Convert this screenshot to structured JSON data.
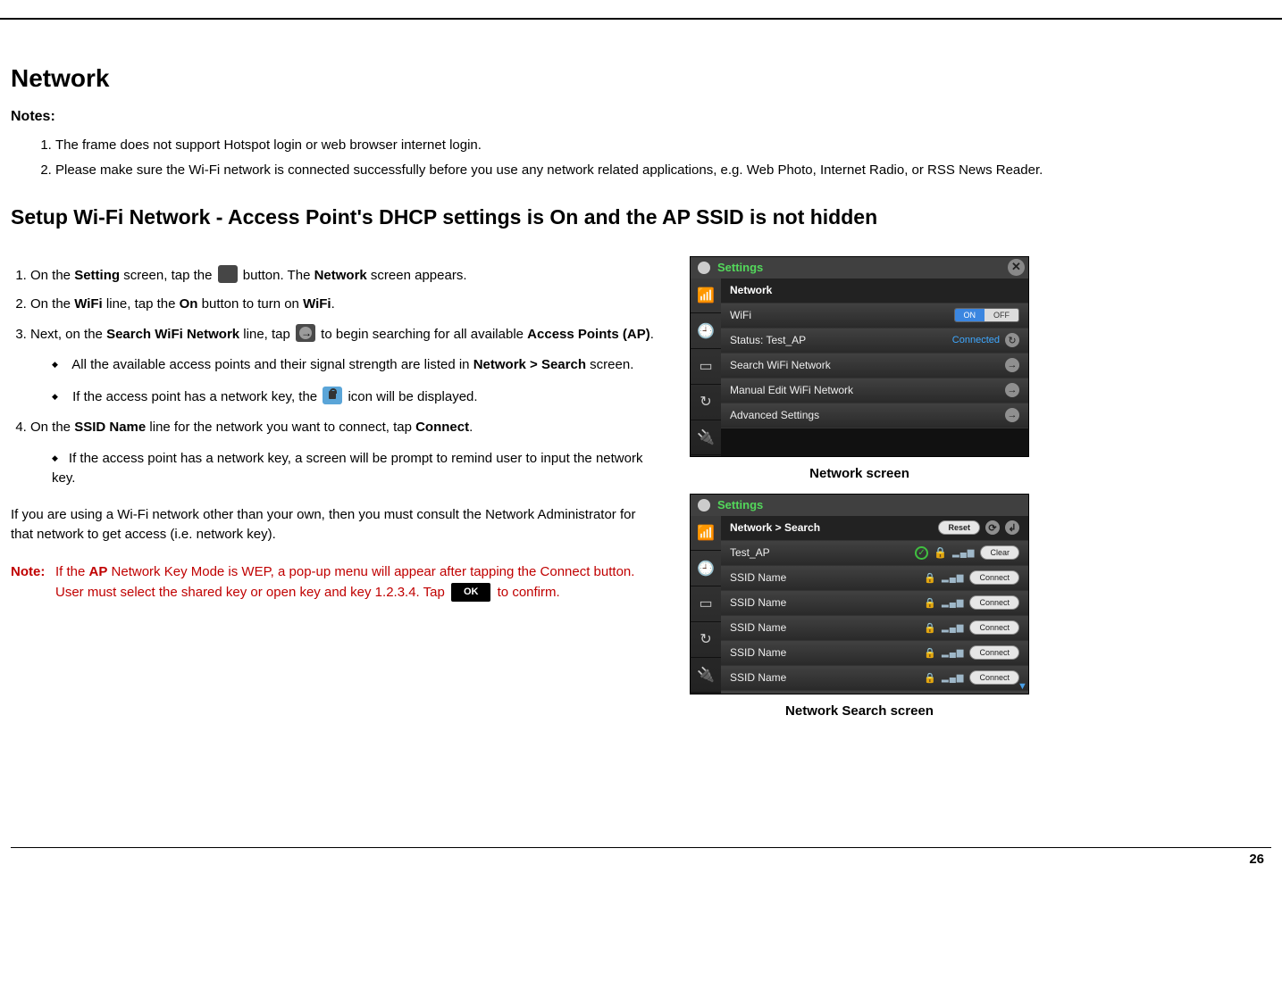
{
  "page_number": "26",
  "title": "Network",
  "notes_label": "Notes:",
  "notes": [
    "The frame does not support Hotspot login or web browser internet login.",
    "Please make sure the Wi-Fi network is connected successfully before you use any network related applications, e.g. Web Photo, Internet Radio, or RSS News Reader."
  ],
  "setup_heading": "Setup Wi-Fi Network - Access Point's DHCP settings is On and the AP SSID is not hidden",
  "steps": {
    "s1_a": "On the ",
    "s1_b": "Setting",
    "s1_c": " screen, tap the ",
    "s1_d": " button.  The ",
    "s1_e": "Network",
    "s1_f": " screen appears.",
    "s2_a": "On the ",
    "s2_b": "WiFi",
    "s2_c": " line, tap the ",
    "s2_d": "On",
    "s2_e": " button to turn on ",
    "s2_f": "WiFi",
    "s2_g": ".",
    "s3_a": "Next, on the ",
    "s3_b": "Search WiFi Network",
    "s3_c": " line, tap ",
    "s3_d": " to begin searching for all available ",
    "s3_e": "Access Points (AP)",
    "s3_f": ".",
    "s3_sub1_a": "All the available access points and their signal strength are listed in ",
    "s3_sub1_b": "Network > Search",
    "s3_sub1_c": " screen.",
    "s3_sub2_a": "If the access point has a network key, the ",
    "s3_sub2_b": " icon will be displayed.",
    "s4_a": "On the ",
    "s4_b": "SSID Name",
    "s4_c": " line for the network you want to connect, tap ",
    "s4_d": "Connect",
    "s4_e": ".",
    "s4_sub1": "If the access point has a network key, a screen will be prompt to remind user to input the network key."
  },
  "body_para": "If you are using a Wi-Fi network other than your own, then you must consult the Network Administrator for that network to get access (i.e. network key).",
  "red_note": {
    "label": "Note:",
    "text_a": "If the ",
    "text_b": "AP",
    "text_c": " Network Key Mode is WEP, a pop-up menu will appear after tapping the Connect button. User must select the shared key or open key and key 1.2.3.4. Tap ",
    "text_d": " to confirm.",
    "ok_label": "OK"
  },
  "screenshot1": {
    "title": "Settings",
    "rows": {
      "network": "Network",
      "wifi": "WiFi",
      "on": "ON",
      "off": "OFF",
      "status_label": "Status: Test_AP",
      "status_value": "Connected",
      "search": "Search WiFi Network",
      "manual": "Manual Edit WiFi Network",
      "advanced": "Advanced Settings"
    },
    "caption": "Network screen"
  },
  "screenshot2": {
    "title": "Settings",
    "breadcrumb": "Network > Search",
    "reset": "Reset",
    "test_ap": "Test_AP",
    "clear": "Clear",
    "ssid": "SSID Name",
    "connect": "Connect",
    "caption": "Network Search screen"
  }
}
